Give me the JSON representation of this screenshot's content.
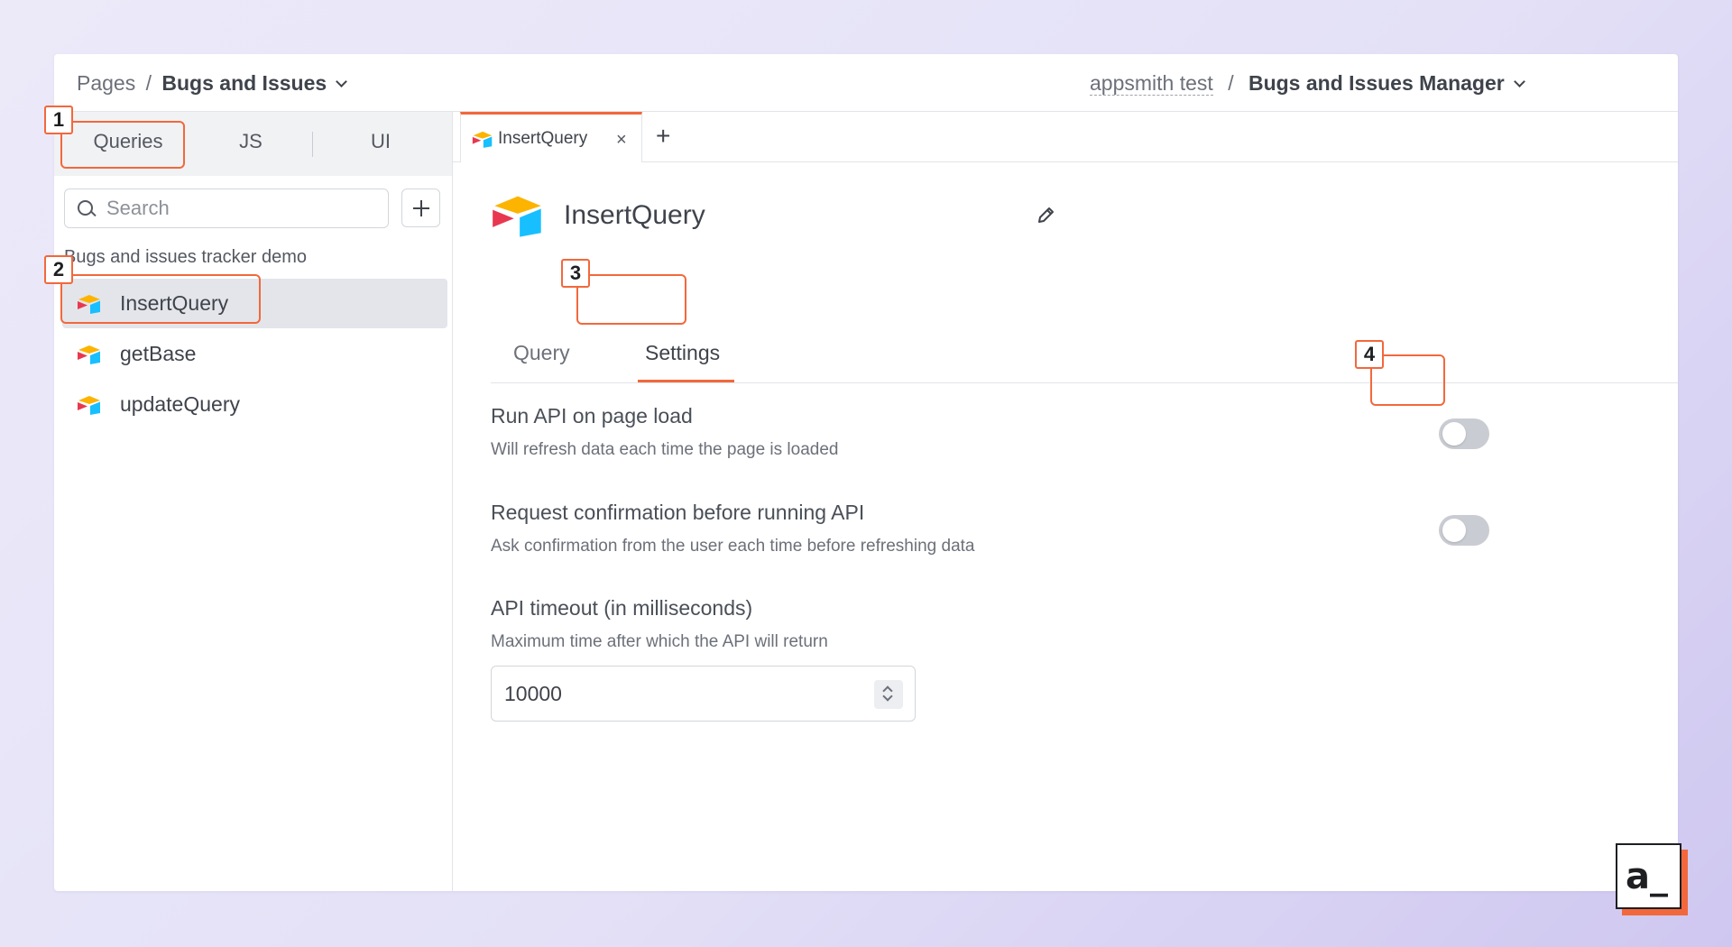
{
  "header": {
    "pages_label": "Pages",
    "separator": "/",
    "current_page": "Bugs and Issues",
    "workspace": "appsmith test",
    "app_separator": "/",
    "app_name": "Bugs and Issues Manager"
  },
  "sidebar": {
    "segments": [
      "Queries",
      "JS",
      "UI"
    ],
    "search": {
      "placeholder": "Search",
      "value": ""
    },
    "group_label": "Bugs and issues tracker demo",
    "items": [
      {
        "label": "InsertQuery",
        "active": true
      },
      {
        "label": "getBase",
        "active": false
      },
      {
        "label": "updateQuery",
        "active": false
      }
    ]
  },
  "editor": {
    "file_tabs": [
      {
        "label": "InsertQuery",
        "close": "×"
      }
    ],
    "new_tab": "+",
    "title": "InsertQuery",
    "pane_tabs": [
      "Query",
      "Settings"
    ],
    "active_pane_tab": "Settings",
    "settings": [
      {
        "title": "Run API on page load",
        "description": "Will refresh data each time the page is loaded",
        "enabled": false
      },
      {
        "title": "Request confirmation before running API",
        "description": "Ask confirmation from the user each time before refreshing data",
        "enabled": false
      }
    ],
    "timeout": {
      "title": "API timeout (in milliseconds)",
      "description": "Maximum time after which the API will return",
      "value": "10000"
    }
  },
  "annotations": [
    "1",
    "2",
    "3",
    "4"
  ],
  "brand": {
    "mark": "a_"
  },
  "colors": {
    "accent": "#f2683c",
    "toggle_off": "#c9ccd2",
    "active_item_bg": "#e3e5ea",
    "airtable_yellow": "#fcb400",
    "airtable_red": "#e8384f",
    "airtable_blue": "#18bfff"
  },
  "icons": {
    "datasource": "airtable-logo-icon",
    "search": "search-icon",
    "add": "plus-icon",
    "edit": "pencil-icon",
    "chevron": "chevron-down-icon",
    "close": "close-icon"
  }
}
